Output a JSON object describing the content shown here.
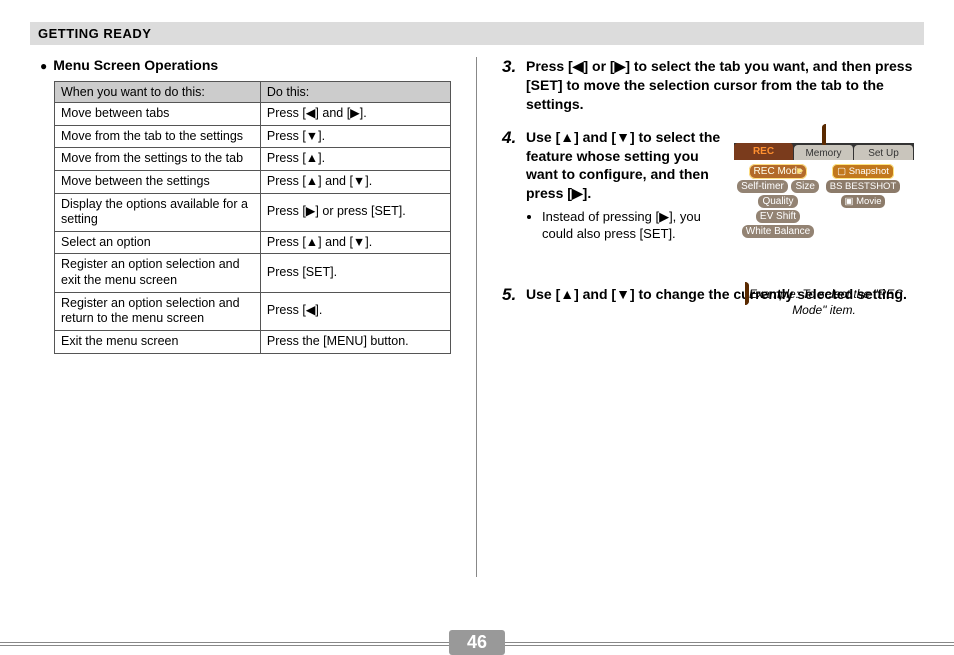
{
  "header": "GETTING READY",
  "page_number": "46",
  "left": {
    "subheading": "Menu Screen Operations",
    "table": {
      "head": [
        "When you want to do this:",
        "Do this:"
      ],
      "rows": [
        [
          "Move between tabs",
          "Press [◀] and [▶]."
        ],
        [
          "Move from the tab to the settings",
          "Press [▼]."
        ],
        [
          "Move from the settings to the tab",
          "Press [▲]."
        ],
        [
          "Move between the settings",
          "Press [▲] and [▼]."
        ],
        [
          "Display the options available for a setting",
          "Press [▶] or press [SET]."
        ],
        [
          "Select an option",
          "Press [▲] and [▼]."
        ],
        [
          "Register an option selection and exit the menu screen",
          "Press [SET]."
        ],
        [
          "Register an option selection and return to the menu screen",
          "Press [◀]."
        ],
        [
          "Exit the menu screen",
          "Press the [MENU] button."
        ]
      ]
    }
  },
  "right": {
    "steps": {
      "s3": {
        "num": "3.",
        "text": "Press [◀] or [▶] to select the tab you want, and then press [SET] to move the selection cursor from the tab to the settings."
      },
      "s4": {
        "num": "4.",
        "text": "Use [▲] and [▼] to select the feature whose setting you want to configure, and then press [▶].",
        "note": "Instead of pressing [▶], you could also press [SET]."
      },
      "s5": {
        "num": "5.",
        "text": "Use [▲] and [▼] to change the currently selected setting."
      }
    },
    "figure": {
      "tabs": [
        "REC",
        "Memory",
        "Set Up"
      ],
      "left_items": [
        "REC Mode",
        "Self-timer",
        "Size",
        "Quality",
        "EV Shift",
        "White Balance"
      ],
      "right_items": [
        "▢ Snapshot",
        "BS BESTSHOT",
        "▣ Movie"
      ],
      "caption": "Example: To select the \"REC Mode\" item."
    }
  }
}
